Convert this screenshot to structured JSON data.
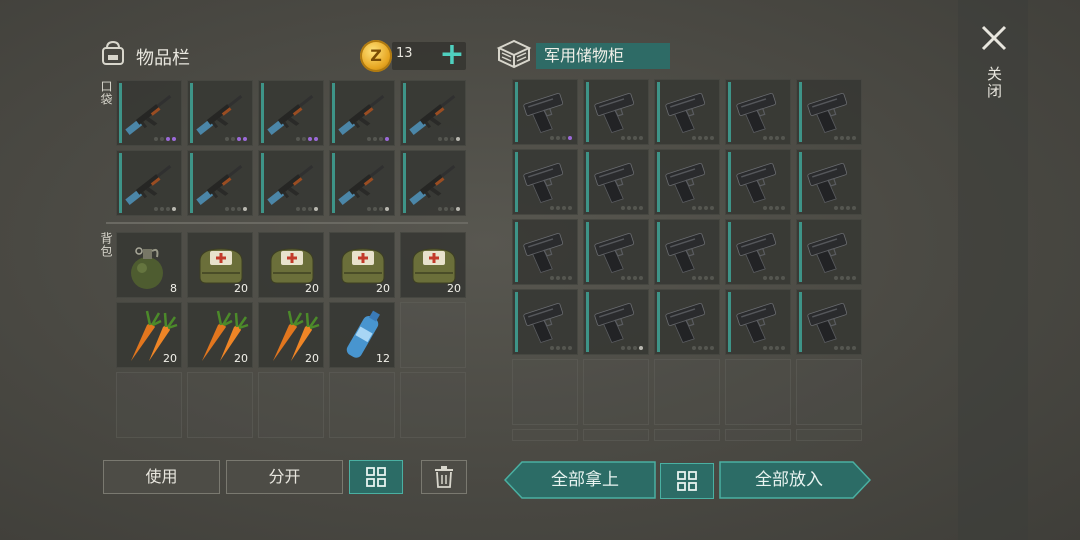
{
  "inventory": {
    "title": "物品栏",
    "title_icon": "backpack-icon",
    "pocket_label": "口袋",
    "backpack_label": "背包",
    "coins": {
      "icon": "coin-icon",
      "symbol": "Z",
      "count": "13",
      "add_icon": "plus-icon"
    },
    "pocket_slots": [
      {
        "item": "rifle",
        "dots": [
          "off",
          "off",
          "purple",
          "purple"
        ]
      },
      {
        "item": "rifle",
        "dots": [
          "off",
          "off",
          "purple",
          "purple"
        ]
      },
      {
        "item": "rifle",
        "dots": [
          "off",
          "off",
          "purple",
          "purple"
        ]
      },
      {
        "item": "rifle",
        "dots": [
          "off",
          "off",
          "off",
          "purple"
        ]
      },
      {
        "item": "rifle",
        "dots": [
          "off",
          "off",
          "off",
          "on"
        ]
      },
      {
        "item": "rifle",
        "dots": [
          "off",
          "off",
          "off",
          "on"
        ]
      },
      {
        "item": "rifle",
        "dots": [
          "off",
          "off",
          "off",
          "on"
        ]
      },
      {
        "item": "rifle",
        "dots": [
          "off",
          "off",
          "off",
          "on"
        ]
      },
      {
        "item": "rifle",
        "dots": [
          "off",
          "off",
          "off",
          "on"
        ]
      },
      {
        "item": "rifle",
        "dots": [
          "off",
          "off",
          "off",
          "on"
        ]
      }
    ],
    "backpack_slots": [
      {
        "item": "grenade",
        "qty": "8"
      },
      {
        "item": "medkit",
        "qty": "20"
      },
      {
        "item": "medkit",
        "qty": "20"
      },
      {
        "item": "medkit",
        "qty": "20"
      },
      {
        "item": "medkit",
        "qty": "20"
      },
      {
        "item": "carrot",
        "qty": "20"
      },
      {
        "item": "carrot",
        "qty": "20"
      },
      {
        "item": "carrot",
        "qty": "20"
      },
      {
        "item": "water-bottle",
        "qty": "12"
      },
      {
        "item": "empty",
        "qty": ""
      },
      {
        "item": "empty",
        "qty": ""
      },
      {
        "item": "empty",
        "qty": ""
      },
      {
        "item": "empty",
        "qty": ""
      },
      {
        "item": "empty",
        "qty": ""
      },
      {
        "item": "empty",
        "qty": ""
      }
    ],
    "buttons": {
      "use": "使用",
      "split": "分开",
      "sort_icon": "grid-icon",
      "trash_icon": "trash-icon"
    }
  },
  "storage": {
    "title": "军用储物柜",
    "title_icon": "crate-icon",
    "slots_item": "pistol",
    "slot_dots_special": {
      "0": "purple",
      "16": "on"
    },
    "buttons": {
      "take_all": "全部拿上",
      "sort_icon": "grid-icon",
      "put_all": "全部放入"
    }
  },
  "close": {
    "icon": "close-icon",
    "label": "关闭"
  },
  "colors": {
    "accent": "#2e6b66",
    "accent_light": "#4fd0bf",
    "purple_dot": "#9b6ad8"
  }
}
